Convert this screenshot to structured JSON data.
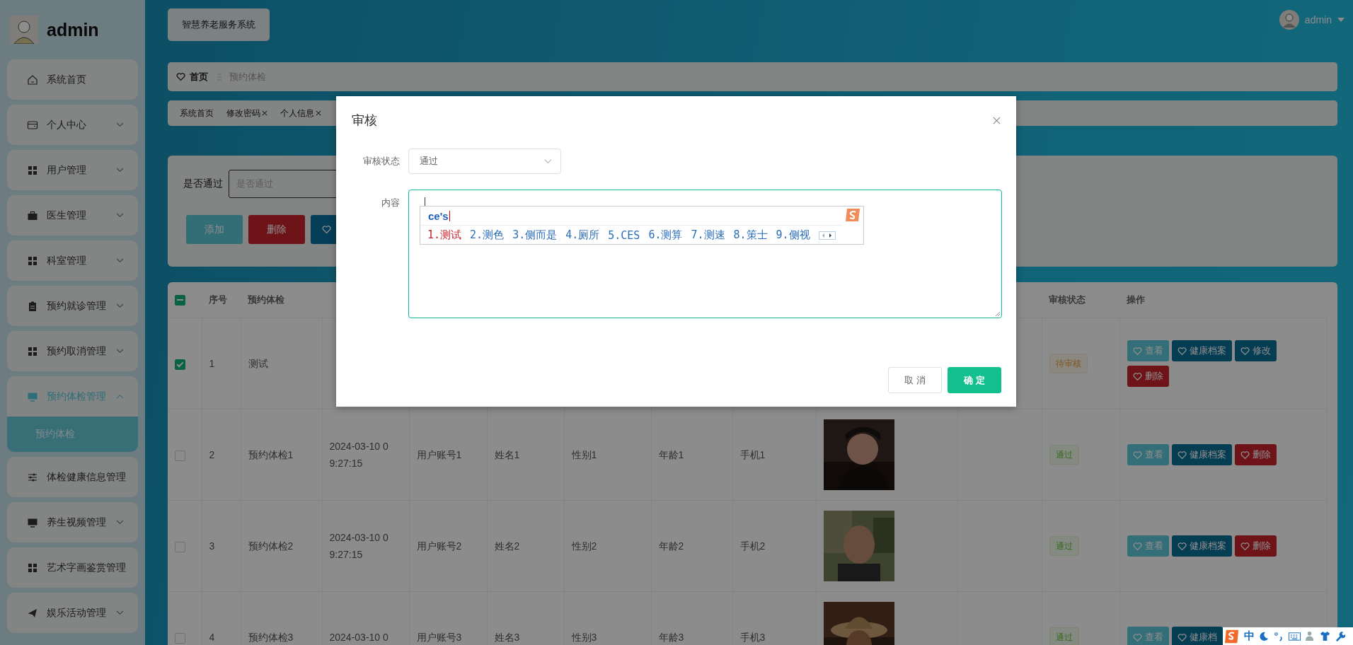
{
  "sidebar": {
    "user": "admin",
    "items": [
      {
        "label": "系统首页"
      },
      {
        "label": "个人中心",
        "expanded": false
      },
      {
        "label": "用户管理",
        "expanded": false
      },
      {
        "label": "医生管理",
        "expanded": false
      },
      {
        "label": "科室管理",
        "expanded": false
      },
      {
        "label": "预约就诊管理",
        "expanded": false
      },
      {
        "label": "预约取消管理",
        "expanded": false
      },
      {
        "label": "预约体检管理",
        "expanded": true,
        "children": [
          {
            "label": "预约体检",
            "selected": true
          }
        ]
      },
      {
        "label": "体检健康信息管理"
      },
      {
        "label": "养生视频管理",
        "expanded": false
      },
      {
        "label": "艺术字画鉴赏管理"
      },
      {
        "label": "娱乐活动管理",
        "expanded": false
      }
    ]
  },
  "header": {
    "system_title": "智慧养老服务系统",
    "user": "admin"
  },
  "breadcrumb": [
    "首页",
    "预约体检"
  ],
  "tabs": [
    {
      "label": "系统首页",
      "closable": false
    },
    {
      "label": "修改密码",
      "closable": true
    },
    {
      "label": "个人信息",
      "closable": true
    }
  ],
  "search": {
    "label": "是否通过",
    "placeholder": "是否通过",
    "buttons": [
      {
        "kind": "add",
        "label": "添加"
      },
      {
        "kind": "delete",
        "label": "删除"
      },
      {
        "kind": "more"
      }
    ]
  },
  "table": {
    "header_checkbox": {
      "indeterminate": true
    },
    "columns_left": [
      "序号",
      "预约体检"
    ],
    "columns_right": [
      "审核状态",
      "操作"
    ],
    "rows": [
      {
        "checked": true,
        "index": "1",
        "name": "测试",
        "status": {
          "label": "待审核",
          "kind": "pending"
        },
        "actions": [
          {
            "kind": "view",
            "label": "查看"
          },
          {
            "kind": "record",
            "label": "健康档案"
          },
          {
            "kind": "edit",
            "label": "修改"
          },
          {
            "kind": "delete",
            "label": "删除"
          }
        ]
      },
      {
        "checked": false,
        "index": "2",
        "name": "预约体检1",
        "date": "2024-03-10 0",
        "time": "9:27:15",
        "account": "用户账号1",
        "person": "姓名1",
        "gender": "性别1",
        "age": "年龄1",
        "phone": "手机1",
        "photo": {
          "kind": "picture"
        },
        "status": {
          "label": "通过",
          "kind": "approved"
        },
        "actions": [
          {
            "kind": "view",
            "label": "查看"
          },
          {
            "kind": "record",
            "label": "健康档案"
          },
          {
            "kind": "delete",
            "label": "删除"
          }
        ]
      },
      {
        "checked": false,
        "index": "3",
        "name": "预约体检2",
        "date": "2024-03-10 0",
        "time": "9:27:15",
        "account": "用户账号2",
        "person": "姓名2",
        "gender": "性别2",
        "age": "年龄2",
        "phone": "手机2",
        "photo": {
          "kind": "picture"
        },
        "status": {
          "label": "通过",
          "kind": "approved"
        },
        "actions": [
          {
            "kind": "view",
            "label": "查看"
          },
          {
            "kind": "record",
            "label": "健康档案"
          },
          {
            "kind": "delete",
            "label": "删除"
          }
        ]
      },
      {
        "checked": false,
        "index": "4",
        "name": "预约体检3",
        "date": "2024-03-10 0",
        "account": "用户账号3",
        "person": "姓名3",
        "gender": "性别3",
        "age": "年龄3",
        "phone": "手机3",
        "photo": {
          "kind": "picture"
        },
        "status": {
          "label": "通过",
          "kind": "approved"
        },
        "actions": [
          {
            "kind": "view",
            "label": "查看"
          },
          {
            "kind": "record",
            "label": "健康档"
          }
        ]
      }
    ]
  },
  "dialog": {
    "title": "审核",
    "fields": [
      {
        "kind": "select",
        "label": "审核状态",
        "value": "通过"
      },
      {
        "kind": "textarea",
        "label": "内容",
        "focused": true
      }
    ],
    "buttons": [
      {
        "kind": "cancel",
        "label": "取 消"
      },
      {
        "kind": "confirm",
        "label": "确 定"
      }
    ]
  },
  "ime": {
    "input": "ce's",
    "candidates": [
      {
        "label": "1.测试",
        "selected": true
      },
      {
        "label": "2.测色",
        "selected": false
      },
      {
        "label": "3.侧而是",
        "selected": false
      },
      {
        "label": "4.厕所",
        "selected": false
      },
      {
        "label": "5.CES",
        "selected": false
      },
      {
        "label": "6.测算",
        "selected": false
      },
      {
        "label": "7.测速",
        "selected": false
      },
      {
        "label": "8.策士",
        "selected": false
      },
      {
        "label": "9.侧视",
        "selected": false
      }
    ],
    "toolbar_mode": "中"
  }
}
